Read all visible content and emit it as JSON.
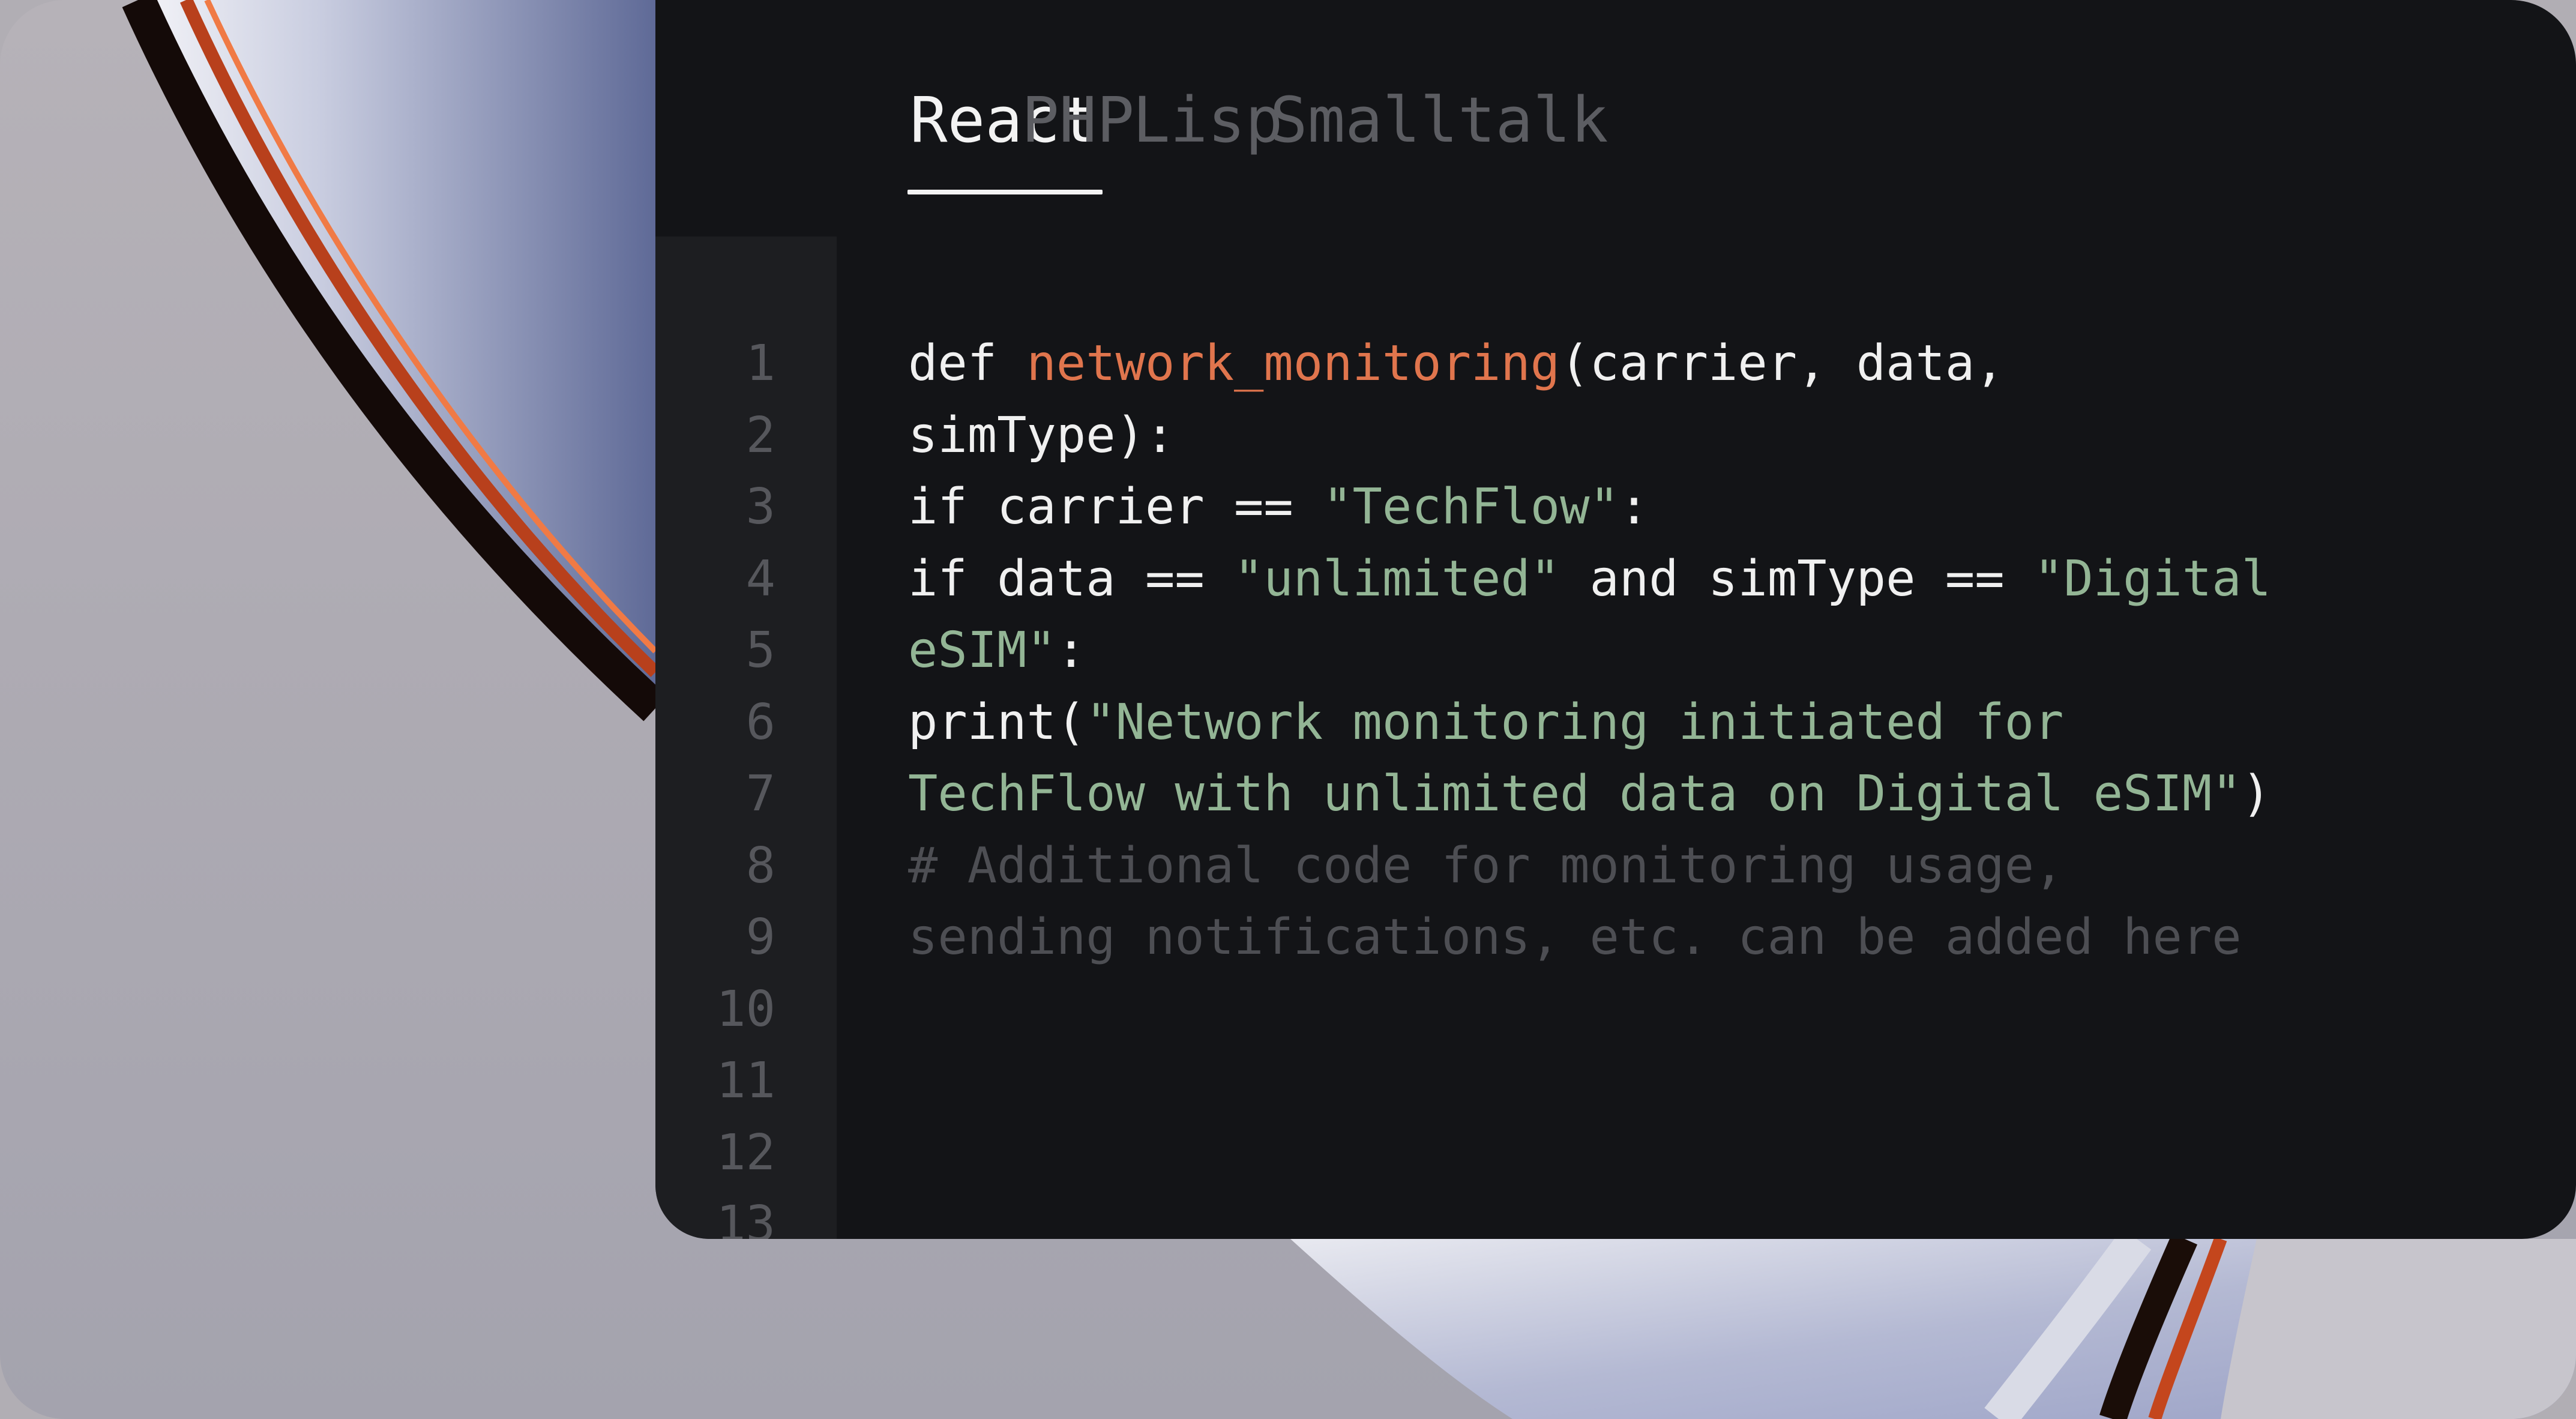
{
  "colors": {
    "editor_bg": "#131417",
    "gutter_bg": "#1d1e21",
    "text": "#f0f0f0",
    "function": "#e0754d",
    "string": "#93b595",
    "comment": "#4d4e53",
    "tab_inactive": "#5c5d62",
    "line_number": "#56575c"
  },
  "tabs": [
    {
      "label": "React",
      "active": true
    },
    {
      "label": "PHP",
      "active": false
    },
    {
      "label": "Lisp",
      "active": false
    },
    {
      "label": "Smalltalk",
      "active": false
    }
  ],
  "line_numbers": [
    "1",
    "2",
    "3",
    "4",
    "5",
    "6",
    "7",
    "8",
    "9",
    "10",
    "11",
    "12",
    "13"
  ],
  "code_lines": [
    [
      {
        "t": "def ",
        "k": "plain"
      },
      {
        "t": "network_monitoring",
        "k": "fn"
      },
      {
        "t": "(carrier, data,",
        "k": "plain"
      }
    ],
    [
      {
        "t": "simType):",
        "k": "plain"
      }
    ],
    [
      {
        "t": "if carrier == ",
        "k": "plain"
      },
      {
        "t": "\"TechFlow\"",
        "k": "str"
      },
      {
        "t": ":",
        "k": "plain"
      }
    ],
    [
      {
        "t": "if data == ",
        "k": "plain"
      },
      {
        "t": "\"unlimited\"",
        "k": "str"
      },
      {
        "t": " and simType == ",
        "k": "plain"
      },
      {
        "t": "\"Digital",
        "k": "str"
      }
    ],
    [
      {
        "t": "eSIM\"",
        "k": "str"
      },
      {
        "t": ":",
        "k": "plain"
      }
    ],
    [
      {
        "t": "print(",
        "k": "plain"
      },
      {
        "t": "\"Network monitoring initiated for",
        "k": "str"
      }
    ],
    [
      {
        "t": "TechFlow with unlimited data on Digital eSIM\"",
        "k": "str"
      },
      {
        "t": ")",
        "k": "plain"
      }
    ],
    [
      {
        "t": "# Additional code for monitoring usage,",
        "k": "cmt"
      }
    ],
    [
      {
        "t": "sending notifications, etc. can be added here",
        "k": "cmt"
      }
    ],
    [],
    [],
    [],
    []
  ]
}
